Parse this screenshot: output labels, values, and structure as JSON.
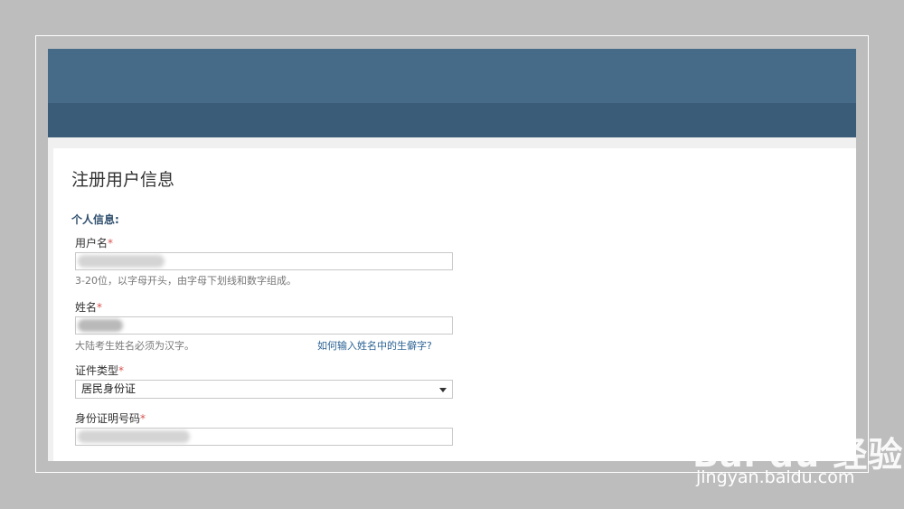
{
  "form": {
    "title": "注册用户信息",
    "section": "个人信息:",
    "username": {
      "label": "用户名",
      "required": "*",
      "hint": "3-20位，以字母开头，由字母下划线和数字组成。"
    },
    "name": {
      "label": "姓名",
      "required": "*",
      "hint": "大陆考生姓名必须为汉字。",
      "help_link": "如何输入姓名中的生僻字?"
    },
    "id_type": {
      "label": "证件类型",
      "required": "*",
      "selected": "居民身份证"
    },
    "id_number": {
      "label": "身份证明号码",
      "required": "*"
    }
  },
  "watermark": {
    "logo": "Bai du 经验",
    "url": "jingyan.baidu.com"
  }
}
